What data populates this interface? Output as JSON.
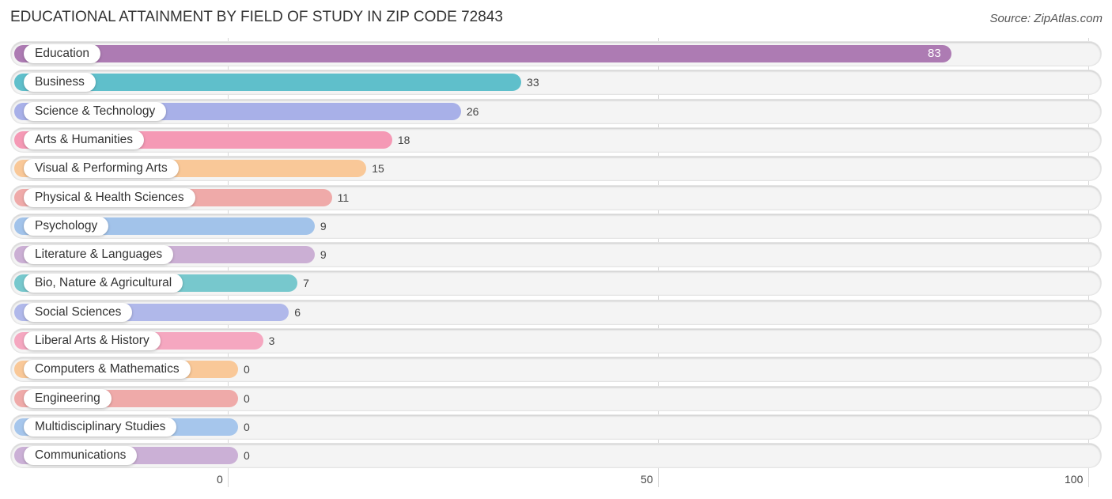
{
  "title": "EDUCATIONAL ATTAINMENT BY FIELD OF STUDY IN ZIP CODE 72843",
  "source": "Source: ZipAtlas.com",
  "chart_data": {
    "type": "bar",
    "orientation": "horizontal",
    "title": "EDUCATIONAL ATTAINMENT BY FIELD OF STUDY IN ZIP CODE 72843",
    "xlabel": "",
    "ylabel": "",
    "xlim": [
      0,
      100
    ],
    "xticks": [
      0,
      50,
      100
    ],
    "xtick_labels": [
      "0",
      "50",
      "100"
    ],
    "grid": true,
    "categories": [
      "Education",
      "Business",
      "Science & Technology",
      "Arts & Humanities",
      "Visual & Performing Arts",
      "Physical & Health Sciences",
      "Psychology",
      "Literature & Languages",
      "Bio, Nature & Agricultural",
      "Social Sciences",
      "Liberal Arts & History",
      "Computers & Mathematics",
      "Engineering",
      "Multidisciplinary Studies",
      "Communications"
    ],
    "values": [
      83,
      33,
      26,
      18,
      15,
      11,
      9,
      9,
      7,
      6,
      3,
      0,
      0,
      0,
      0
    ],
    "value_labels": [
      "83",
      "33",
      "26",
      "18",
      "15",
      "11",
      "9",
      "9",
      "7",
      "6",
      "3",
      "0",
      "0",
      "0",
      "0"
    ],
    "colors": [
      "#ad7bb3",
      "#5fbfcb",
      "#a8b0e8",
      "#f599b5",
      "#f9c898",
      "#efaaa9",
      "#a2c3ea",
      "#cbafd4",
      "#77c8cd",
      "#b0b8ea",
      "#f5a7c0",
      "#f9c898",
      "#efaaa9",
      "#a6c6ec",
      "#cbb0d6"
    ]
  }
}
